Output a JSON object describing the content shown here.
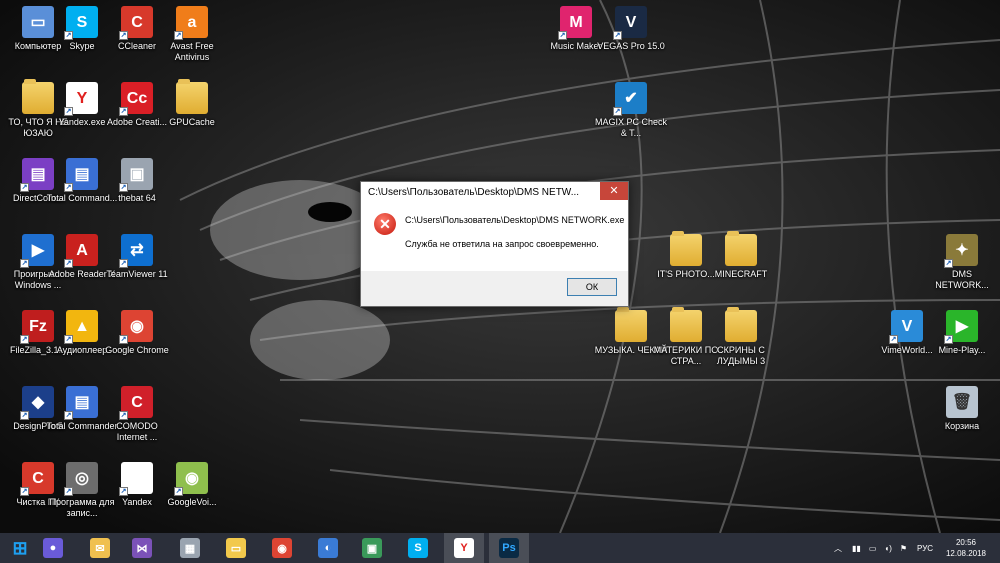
{
  "desktop": {
    "icons": [
      {
        "label": "Компьютер",
        "icon": "computer-icon",
        "color": "#5a8fd8"
      },
      {
        "label": "Skype",
        "icon": "skype-icon",
        "color": "#00aff0"
      },
      {
        "label": "CCleaner",
        "icon": "ccleaner-icon",
        "color": "#d7392b"
      },
      {
        "label": "Avast Free Antivirus",
        "icon": "avast-icon",
        "color": "#f07d1a"
      },
      {
        "label": "ТО, ЧТО Я НЕ ЮЗАЮ",
        "icon": "folder-icon",
        "color": "#e8c04f"
      },
      {
        "label": "Yandex.exe",
        "icon": "yandex-browser-icon",
        "color": "#ffffff"
      },
      {
        "label": "Adobe Creati...",
        "icon": "adobe-creative-cloud-icon",
        "color": "#da1f26"
      },
      {
        "label": "GPUCache",
        "icon": "folder-icon",
        "color": "#e8c04f"
      },
      {
        "label": "DirectCom...",
        "icon": "directcom-icon",
        "color": "#7b3fc4"
      },
      {
        "label": "Total Command...",
        "icon": "total-commander-icon",
        "color": "#3a6fd4"
      },
      {
        "label": "thebat 64",
        "icon": "thebat-icon",
        "color": "#9aa4b0"
      },
      {
        "label": "Проигрыв... Windows ...",
        "icon": "windows-media-player-icon",
        "color": "#1f6fd0"
      },
      {
        "label": "Adobe Reader X",
        "icon": "adobe-reader-icon",
        "color": "#c9211e"
      },
      {
        "label": "TeamViewer 11",
        "icon": "teamviewer-icon",
        "color": "#0e6fd0"
      },
      {
        "label": "FileZilla_3.1...",
        "icon": "filezilla-icon",
        "color": "#bf1e1e"
      },
      {
        "label": "Аудиоплеер",
        "icon": "aimp-icon",
        "color": "#f2b60f"
      },
      {
        "label": "Google Chrome",
        "icon": "chrome-icon",
        "color": "#dd4433"
      },
      {
        "label": "DesignPro 5",
        "icon": "designpro-icon",
        "color": "#1c3f8a"
      },
      {
        "label": "Total Commander",
        "icon": "total-commander-icon",
        "color": "#3a6fd4"
      },
      {
        "label": "COMODO Internet ...",
        "icon": "comodo-icon",
        "color": "#d0202a"
      },
      {
        "label": "Чистка ПК",
        "icon": "ccleaner-icon",
        "color": "#d7392b"
      },
      {
        "label": "Программа для запис...",
        "icon": "infrarecorder-icon",
        "color": "#6d6d6d"
      },
      {
        "label": "Yandex",
        "icon": "document-icon",
        "color": "#ffffff"
      },
      {
        "label": "GoogleVoi...",
        "icon": "google-voice-installer-icon",
        "color": "#8fbf4d"
      },
      {
        "label": "Music Maker",
        "icon": "music-maker-icon",
        "color": "#e0246e"
      },
      {
        "label": "VEGAS Pro 15.0",
        "icon": "vegas-pro-icon",
        "color": "#1a2a44"
      },
      {
        "label": "MAGIX PC Check & T...",
        "icon": "magix-pc-check-icon",
        "color": "#1c7ec8"
      },
      {
        "label": "IT'S PHOTO...",
        "icon": "folder-icon",
        "color": "#e8c04f"
      },
      {
        "label": "MINECRAFT",
        "icon": "folder-icon",
        "color": "#e8c04f"
      },
      {
        "label": "МУЗЫКА. ЧЕКАЙ",
        "icon": "folder-icon",
        "color": "#e8c04f"
      },
      {
        "label": "МАТЕРИКИ ПО СТРА...",
        "icon": "folder-icon",
        "color": "#e8c04f"
      },
      {
        "label": "СКРИНЫ С ЛУДЫМЫ 3",
        "icon": "folder-icon",
        "color": "#e8c04f"
      },
      {
        "label": "DMS NETWORK...",
        "icon": "dms-network-icon",
        "color": "#8a7a3a"
      },
      {
        "label": "VimeWorld...",
        "icon": "vimeworld-icon",
        "color": "#2a8bd8"
      },
      {
        "label": "Mine-Play...",
        "icon": "mine-play-icon",
        "color": "#2ab52a"
      },
      {
        "label": "Корзина",
        "icon": "recycle-bin-icon",
        "color": "#b8c4d0"
      }
    ]
  },
  "dialog": {
    "title": "C:\\Users\\Пользователь\\Desktop\\DMS NETW...",
    "close_glyph": "✕",
    "path": "C:\\Users\\Пользователь\\Desktop\\DMS NETWORK.exe",
    "message": "Служба не ответила на запрос своевременно.",
    "ok_label": "ОК",
    "error_glyph": "✕"
  },
  "taskbar": {
    "items": [
      {
        "icon": "start-icon",
        "color": "#1ea0f0"
      },
      {
        "icon": "microphone-icon",
        "color": "#6a5bd8"
      },
      {
        "icon": "mail-icon",
        "color": "#f0c04f"
      },
      {
        "icon": "visual-studio-icon",
        "color": "#7b52b8"
      },
      {
        "icon": "calculator-icon",
        "color": "#9aa4b0"
      },
      {
        "icon": "file-explorer-icon",
        "color": "#f2c94c"
      },
      {
        "icon": "chrome-icon",
        "color": "#dd4433"
      },
      {
        "icon": "thunderbird-icon",
        "color": "#3a7bd5"
      },
      {
        "icon": "app-window-icon",
        "color": "#3a9a5a"
      },
      {
        "icon": "skype-icon",
        "color": "#00aff0"
      },
      {
        "icon": "yandex-browser-icon",
        "color": "#ffffff"
      },
      {
        "icon": "photoshop-icon",
        "color": "#0a2a44"
      }
    ],
    "tray_language": "РУС",
    "time": "20:56",
    "date": "12.08.2018"
  },
  "colors": {
    "dialog_close": "#c7463a",
    "taskbar": "#2b2f3a"
  }
}
